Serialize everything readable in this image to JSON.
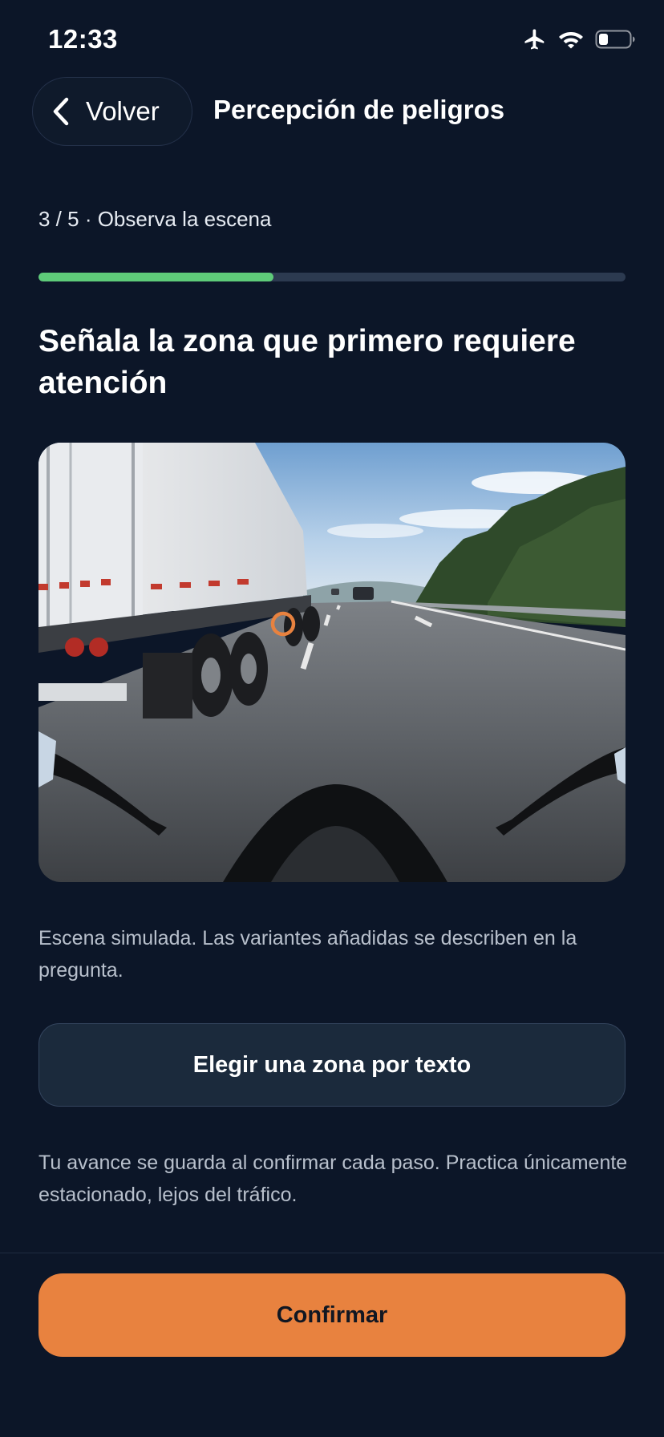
{
  "status_bar": {
    "time": "12:33",
    "icons": [
      "airplane-icon",
      "wifi-icon",
      "battery-icon"
    ]
  },
  "header": {
    "back_label": "Volver",
    "title": "Percepción de peligros"
  },
  "step": {
    "label": "3 / 5 · Observa la escena",
    "current": 3,
    "total": 5,
    "progress_fraction": 0.4
  },
  "question": "Señala la zona que primero requiere atención",
  "scene": {
    "caption": "Escena simulada. Las variantes añadidas se describen en la pregunta."
  },
  "text_zone_button_label": "Elegir una zona por texto",
  "note": "Tu avance se guarda al confirmar cada paso. Practica únicamente estacionado, lejos del tráfico.",
  "confirm_label": "Confirmar",
  "colors": {
    "background": "#0c1628",
    "progress": "#5ecb79",
    "accent": "#e8823f",
    "marker": "#e8823f"
  }
}
